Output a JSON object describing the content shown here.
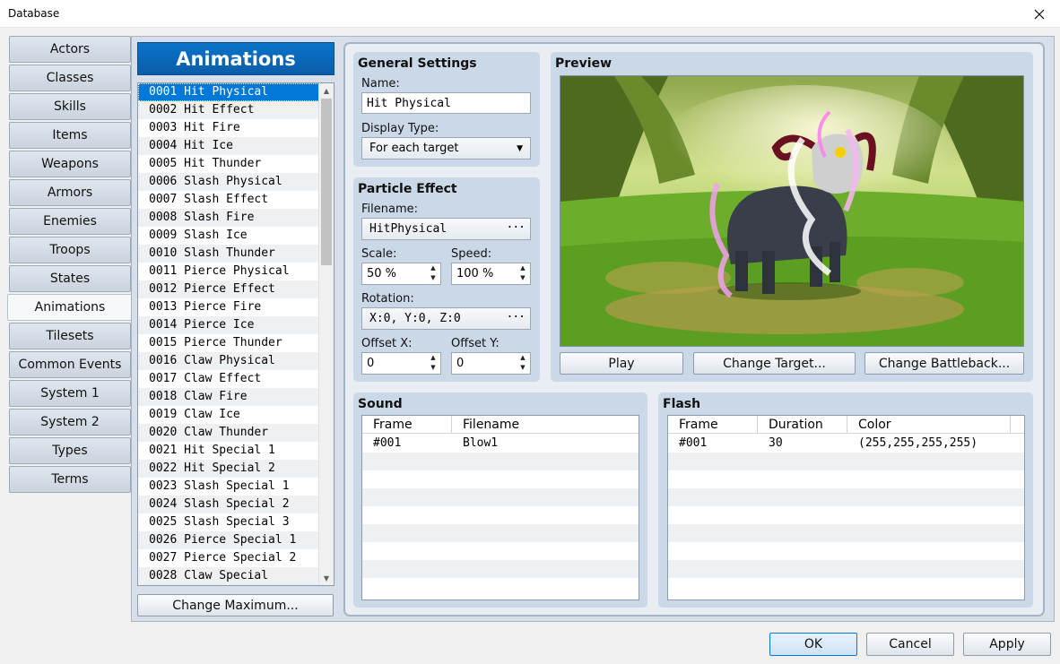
{
  "window": {
    "title": "Database"
  },
  "tabs": [
    "Actors",
    "Classes",
    "Skills",
    "Items",
    "Weapons",
    "Armors",
    "Enemies",
    "Troops",
    "States",
    "Animations",
    "Tilesets",
    "Common Events",
    "System 1",
    "System 2",
    "Types",
    "Terms"
  ],
  "active_tab": "Animations",
  "list": {
    "heading": "Animations",
    "items": [
      "0001 Hit Physical",
      "0002 Hit Effect",
      "0003 Hit Fire",
      "0004 Hit Ice",
      "0005 Hit Thunder",
      "0006 Slash Physical",
      "0007 Slash Effect",
      "0008 Slash Fire",
      "0009 Slash Ice",
      "0010 Slash Thunder",
      "0011 Pierce Physical",
      "0012 Pierce Effect",
      "0013 Pierce Fire",
      "0014 Pierce Ice",
      "0015 Pierce Thunder",
      "0016 Claw Physical",
      "0017 Claw Effect",
      "0018 Claw Fire",
      "0019 Claw Ice",
      "0020 Claw Thunder",
      "0021 Hit Special 1",
      "0022 Hit Special 2",
      "0023 Slash Special 1",
      "0024 Slash Special 2",
      "0025 Slash Special 3",
      "0026 Pierce Special 1",
      "0027 Pierce Special 2",
      "0028 Claw Special"
    ],
    "selected_index": 0,
    "change_maximum": "Change Maximum..."
  },
  "general": {
    "title": "General Settings",
    "name_label": "Name:",
    "name_value": "Hit Physical",
    "display_type_label": "Display Type:",
    "display_type_value": "For each target"
  },
  "particle": {
    "title": "Particle Effect",
    "filename_label": "Filename:",
    "filename_value": "HitPhysical",
    "scale_label": "Scale:",
    "scale_value": "50 %",
    "speed_label": "Speed:",
    "speed_value": "100 %",
    "rotation_label": "Rotation:",
    "rotation_value": "X:0, Y:0, Z:0",
    "offset_x_label": "Offset X:",
    "offset_x_value": "0",
    "offset_y_label": "Offset Y:",
    "offset_y_value": "0"
  },
  "preview": {
    "title": "Preview",
    "play": "Play",
    "change_target": "Change Target...",
    "change_battleback": "Change Battleback..."
  },
  "sound": {
    "title": "Sound",
    "columns": [
      "Frame",
      "Filename"
    ],
    "rows": [
      [
        "#001",
        "Blow1"
      ]
    ]
  },
  "flash": {
    "title": "Flash",
    "columns": [
      "Frame",
      "Duration",
      "Color"
    ],
    "rows": [
      [
        "#001",
        "30",
        "(255,255,255,255)"
      ]
    ]
  },
  "footer": {
    "ok": "OK",
    "cancel": "Cancel",
    "apply": "Apply"
  },
  "colors": {
    "accent": "#0078d7",
    "list_heading": "#0b66b5",
    "panel": "#cad8e7"
  }
}
